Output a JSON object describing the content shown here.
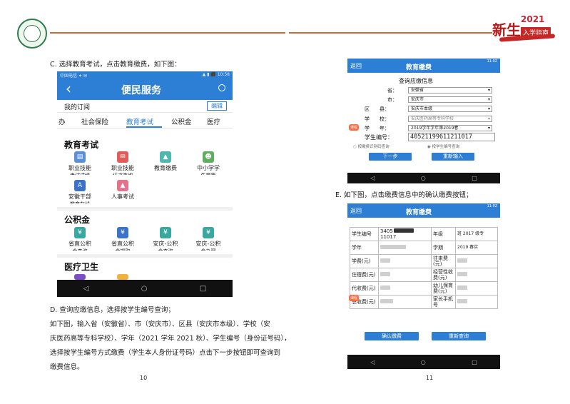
{
  "header": {
    "brand_main": "新生",
    "brand_year": "2021",
    "brand_sub": "入学指南"
  },
  "left_page": {
    "step_c": "C. 选择教育考试，点击教育缴费，如下图：",
    "phone1": {
      "status_left": "中国电信 ✦ ✉",
      "status_right": "▲ ▮ ⬛ 10:58",
      "back": "‹",
      "title": "便民服务",
      "subscribe_label": "我的订阅",
      "edit_btn": "编辑",
      "tabs": [
        "办",
        "社会保险",
        "教育考试",
        "公积金",
        "医疗"
      ],
      "section_edu": "教育考试",
      "edu_items": [
        {
          "l1": "职业技能",
          "l2": "考试成绩"
        },
        {
          "l1": "职业技能",
          "l2": "证书查询"
        },
        {
          "l1": "教育缴费",
          "l2": ""
        },
        {
          "l1": "中小学学",
          "l2": "生学籍"
        },
        {
          "l1": "安徽干部",
          "l2": "教育在线"
        },
        {
          "l1": "人事考试",
          "l2": ""
        }
      ],
      "section_fund": "公积金",
      "fund_items": [
        {
          "l1": "省直公积",
          "l2": "金查询"
        },
        {
          "l1": "省直公积",
          "l2": "金提取"
        },
        {
          "l1": "安庆-公积",
          "l2": "金查询"
        },
        {
          "l1": "安庆-公积",
          "l2": "金办理"
        }
      ],
      "section_med": "医疗卫生"
    },
    "step_d": "D. 查询应缴信息，选择按学生编号查询；",
    "para_lines": [
      "如下图，输入省（安徽省）、市（安庆市）、区县（安庆市本级）、学校（安",
      "庆医药高等专科学校）、学年（2021 学年 2021 秋）、学生编号（身份证号码），",
      "选择按学生编号方式缴费（学生本人身份证号码）点击下一步按钮即可查询到",
      "缴费信息。"
    ],
    "page_num": "10"
  },
  "right_page": {
    "phone2": {
      "back": "返回",
      "title": "教育缴费",
      "status_right": "11:02",
      "form_title": "查询应缴信息",
      "fields": [
        {
          "label": "省：",
          "value": "安徽省"
        },
        {
          "label": "市：",
          "value": "安庆市"
        },
        {
          "label": "区　　县：",
          "value": "安庆市本级"
        },
        {
          "label": "学　　校：",
          "value": "安庆医药高等专科学校"
        },
        {
          "label": "学　　年：",
          "value": "2019学年学年第2019春"
        },
        {
          "label": "学生编号：",
          "value": "40521199611211017"
        }
      ],
      "radio1": "按缴费识别码查询",
      "radio2": "按学生编号查询",
      "next_btn": "下一步",
      "reset_btn": "重新输入",
      "float_badge": "课程"
    },
    "step_e": "E. 如下图，点击缴费信息中的确认缴费按钮；",
    "phone3": {
      "back": "返回",
      "title": "教育缴费",
      "status_right": "11:02",
      "rows": [
        {
          "l": "学生编号",
          "v": "3405",
          "v2": "11017",
          "l2": "年级",
          "r": "班 2017 级专"
        },
        {
          "l": "学年",
          "v": "",
          "v2": "",
          "l2": "学期",
          "r": "2019 春实"
        },
        {
          "l": "学费(元)",
          "v": "",
          "v2": "",
          "l2": "往来费(元)",
          "r": ""
        },
        {
          "l": "住宿费(元)",
          "v": "",
          "v2": "",
          "l2": "经营性收费(元)",
          "r": ""
        },
        {
          "l": "代收费(元)",
          "v": "",
          "v2": "",
          "l2": "幼儿保育费(元)",
          "r": ""
        },
        {
          "l": "总收费(元)",
          "v": "",
          "v2": "",
          "l2": "家长手机号",
          "r": ""
        }
      ],
      "confirm_btn": "确认缴费",
      "requery_btn": "重新查询",
      "float_badge": "课程"
    },
    "page_num": "11"
  },
  "colors": {
    "app_blue": "#2d7fd6",
    "header_orange": "#d06a2a",
    "brand_red": "#c62828"
  }
}
